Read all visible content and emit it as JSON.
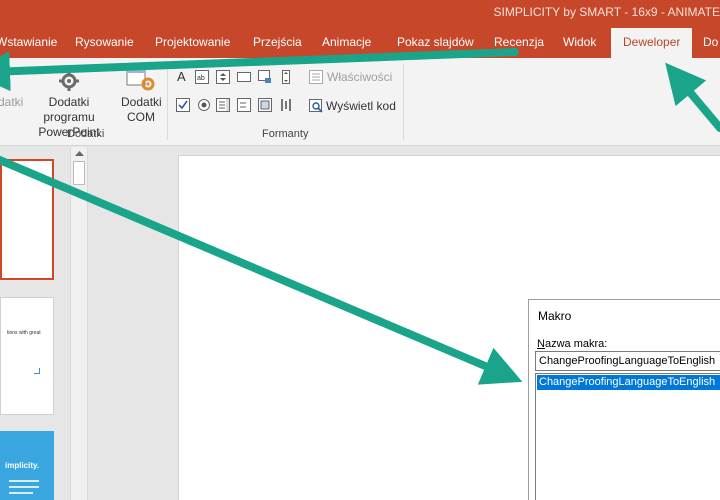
{
  "window": {
    "title": "SIMPLICITY by SMART - 16x9 - ANIMATE"
  },
  "tabs": [
    {
      "label": "Wstawianie"
    },
    {
      "label": "Rysowanie"
    },
    {
      "label": "Projektowanie"
    },
    {
      "label": "Przejścia"
    },
    {
      "label": "Animacje"
    },
    {
      "label": "Pokaz slajdów"
    },
    {
      "label": "Recenzja"
    },
    {
      "label": "Widok"
    },
    {
      "label": "Deweloper",
      "active": true
    },
    {
      "label": "Do"
    }
  ],
  "ribbon": {
    "addins_partial": "datki",
    "addins_powerpoint": "Dodatki programu PowerPoint",
    "addins_com": "Dodatki COM",
    "group_addins": "Dodatki",
    "properties": "Właściwości",
    "view_code": "Wyświetl kod",
    "group_controls": "Formanty"
  },
  "slides": {
    "slide2_text": "tions with great",
    "slide3_text": "implicity."
  },
  "macro_dialog": {
    "title": "Makro",
    "name_label": "Nazwa makra:",
    "name_value": "ChangeProofingLanguageToEnglish",
    "list_items": [
      "ChangeProofingLanguageToEnglish"
    ]
  },
  "colors": {
    "accent": "#c7472a",
    "arrow": "#1aa58a",
    "selection": "#0078d7"
  }
}
